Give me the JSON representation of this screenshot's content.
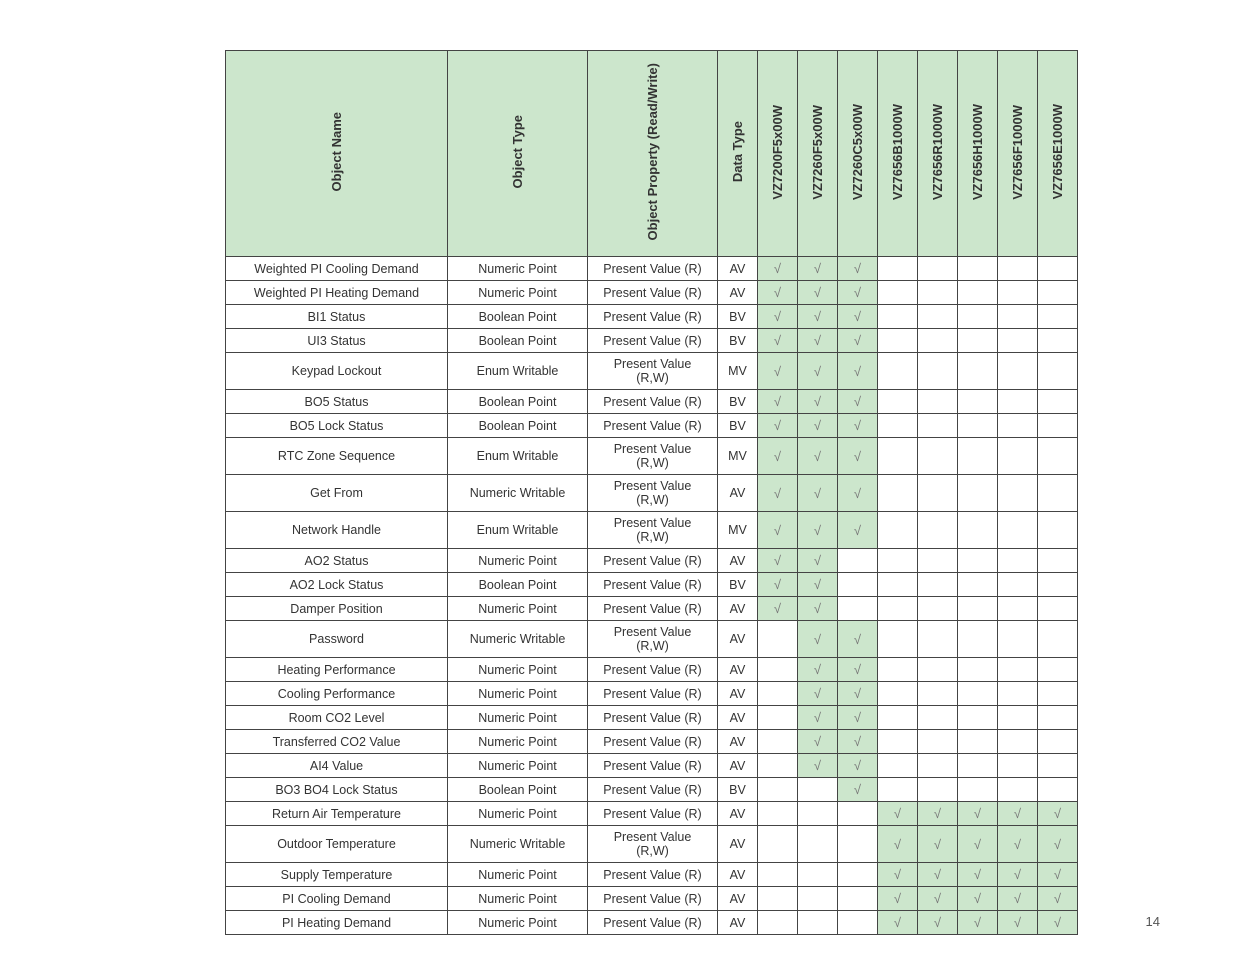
{
  "page_number": "14",
  "tick": "√",
  "headers": {
    "object_name": "Object Name",
    "object_type": "Object Type",
    "object_property": "Object Property (Read/Write)",
    "data_type": "Data Type",
    "models": [
      "VZ7200F5x00W",
      "VZ7260F5x00W",
      "VZ7260C5x00W",
      "VZ7656B1000W",
      "VZ7656R1000W",
      "VZ7656H1000W",
      "VZ7656F1000W",
      "VZ7656E1000W"
    ]
  },
  "rows": [
    {
      "name": "Weighted PI Cooling Demand",
      "type": "Numeric Point",
      "prop": "Present Value (R)",
      "dtype": "AV",
      "marks": [
        1,
        1,
        1,
        0,
        0,
        0,
        0,
        0
      ]
    },
    {
      "name": "Weighted PI Heating Demand",
      "type": "Numeric Point",
      "prop": "Present Value (R)",
      "dtype": "AV",
      "marks": [
        1,
        1,
        1,
        0,
        0,
        0,
        0,
        0
      ]
    },
    {
      "name": "BI1 Status",
      "type": "Boolean Point",
      "prop": "Present Value (R)",
      "dtype": "BV",
      "marks": [
        1,
        1,
        1,
        0,
        0,
        0,
        0,
        0
      ]
    },
    {
      "name": "UI3 Status",
      "type": "Boolean Point",
      "prop": "Present Value (R)",
      "dtype": "BV",
      "marks": [
        1,
        1,
        1,
        0,
        0,
        0,
        0,
        0
      ]
    },
    {
      "name": "Keypad Lockout",
      "type": "Enum Writable",
      "prop": "Present Value (R,W)",
      "dtype": "MV",
      "marks": [
        1,
        1,
        1,
        0,
        0,
        0,
        0,
        0
      ]
    },
    {
      "name": "BO5 Status",
      "type": "Boolean Point",
      "prop": "Present Value (R)",
      "dtype": "BV",
      "marks": [
        1,
        1,
        1,
        0,
        0,
        0,
        0,
        0
      ]
    },
    {
      "name": "BO5 Lock Status",
      "type": "Boolean Point",
      "prop": "Present Value (R)",
      "dtype": "BV",
      "marks": [
        1,
        1,
        1,
        0,
        0,
        0,
        0,
        0
      ]
    },
    {
      "name": "RTC Zone Sequence",
      "type": "Enum Writable",
      "prop": "Present Value (R,W)",
      "dtype": "MV",
      "marks": [
        1,
        1,
        1,
        0,
        0,
        0,
        0,
        0
      ]
    },
    {
      "name": "Get From",
      "type": "Numeric Writable",
      "prop": "Present Value (R,W)",
      "dtype": "AV",
      "marks": [
        1,
        1,
        1,
        0,
        0,
        0,
        0,
        0
      ]
    },
    {
      "name": "Network Handle",
      "type": "Enum Writable",
      "prop": "Present Value (R,W)",
      "dtype": "MV",
      "marks": [
        1,
        1,
        1,
        0,
        0,
        0,
        0,
        0
      ]
    },
    {
      "name": "AO2 Status",
      "type": "Numeric Point",
      "prop": "Present Value (R)",
      "dtype": "AV",
      "marks": [
        1,
        1,
        0,
        0,
        0,
        0,
        0,
        0
      ]
    },
    {
      "name": "AO2 Lock Status",
      "type": "Boolean Point",
      "prop": "Present Value (R)",
      "dtype": "BV",
      "marks": [
        1,
        1,
        0,
        0,
        0,
        0,
        0,
        0
      ]
    },
    {
      "name": "Damper Position",
      "type": "Numeric Point",
      "prop": "Present Value (R)",
      "dtype": "AV",
      "marks": [
        1,
        1,
        0,
        0,
        0,
        0,
        0,
        0
      ]
    },
    {
      "name": "Password",
      "type": "Numeric Writable",
      "prop": "Present Value (R,W)",
      "dtype": "AV",
      "marks": [
        0,
        1,
        1,
        0,
        0,
        0,
        0,
        0
      ]
    },
    {
      "name": "Heating Performance",
      "type": "Numeric Point",
      "prop": "Present Value (R)",
      "dtype": "AV",
      "marks": [
        0,
        1,
        1,
        0,
        0,
        0,
        0,
        0
      ]
    },
    {
      "name": "Cooling Performance",
      "type": "Numeric Point",
      "prop": "Present Value (R)",
      "dtype": "AV",
      "marks": [
        0,
        1,
        1,
        0,
        0,
        0,
        0,
        0
      ]
    },
    {
      "name": "Room CO2 Level",
      "type": "Numeric Point",
      "prop": "Present Value (R)",
      "dtype": "AV",
      "marks": [
        0,
        1,
        1,
        0,
        0,
        0,
        0,
        0
      ]
    },
    {
      "name": "Transferred CO2 Value",
      "type": "Numeric Point",
      "prop": "Present Value (R)",
      "dtype": "AV",
      "marks": [
        0,
        1,
        1,
        0,
        0,
        0,
        0,
        0
      ]
    },
    {
      "name": "AI4 Value",
      "type": "Numeric Point",
      "prop": "Present Value (R)",
      "dtype": "AV",
      "marks": [
        0,
        1,
        1,
        0,
        0,
        0,
        0,
        0
      ]
    },
    {
      "name": "BO3 BO4 Lock Status",
      "type": "Boolean Point",
      "prop": "Present Value (R)",
      "dtype": "BV",
      "marks": [
        0,
        0,
        1,
        0,
        0,
        0,
        0,
        0
      ]
    },
    {
      "name": "Return Air Temperature",
      "type": "Numeric Point",
      "prop": "Present Value (R)",
      "dtype": "AV",
      "marks": [
        0,
        0,
        0,
        1,
        1,
        1,
        1,
        1
      ]
    },
    {
      "name": "Outdoor Temperature",
      "type": "Numeric Writable",
      "prop": "Present Value (R,W)",
      "dtype": "AV",
      "marks": [
        0,
        0,
        0,
        1,
        1,
        1,
        1,
        1
      ]
    },
    {
      "name": "Supply Temperature",
      "type": "Numeric Point",
      "prop": "Present Value (R)",
      "dtype": "AV",
      "marks": [
        0,
        0,
        0,
        1,
        1,
        1,
        1,
        1
      ]
    },
    {
      "name": "PI Cooling Demand",
      "type": "Numeric Point",
      "prop": "Present Value (R)",
      "dtype": "AV",
      "marks": [
        0,
        0,
        0,
        1,
        1,
        1,
        1,
        1
      ]
    },
    {
      "name": "PI Heating Demand",
      "type": "Numeric Point",
      "prop": "Present Value (R)",
      "dtype": "AV",
      "marks": [
        0,
        0,
        0,
        1,
        1,
        1,
        1,
        1
      ]
    }
  ]
}
